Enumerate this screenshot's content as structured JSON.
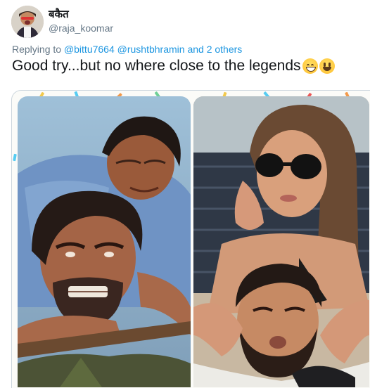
{
  "tweet": {
    "display_name": "बकैत",
    "handle": "@raja_koomar",
    "replying_prefix": "Replying to",
    "replying_mentions": "@bittu7664 @rushtbhramin",
    "replying_others": "and 2 others",
    "text": "Good try...but no where close to the legends",
    "emojis": [
      "grinning-face-with-smiling-eyes",
      "smiling-face-with-open-mouth"
    ]
  },
  "media": {
    "left_photo": "two men struggling, one on another's back",
    "right_photo": "woman in sunglasses resting on a man's head"
  },
  "colors": {
    "text": "#14171a",
    "secondary": "#657786",
    "link": "#1b95e0",
    "border": "#ccd6dd"
  }
}
